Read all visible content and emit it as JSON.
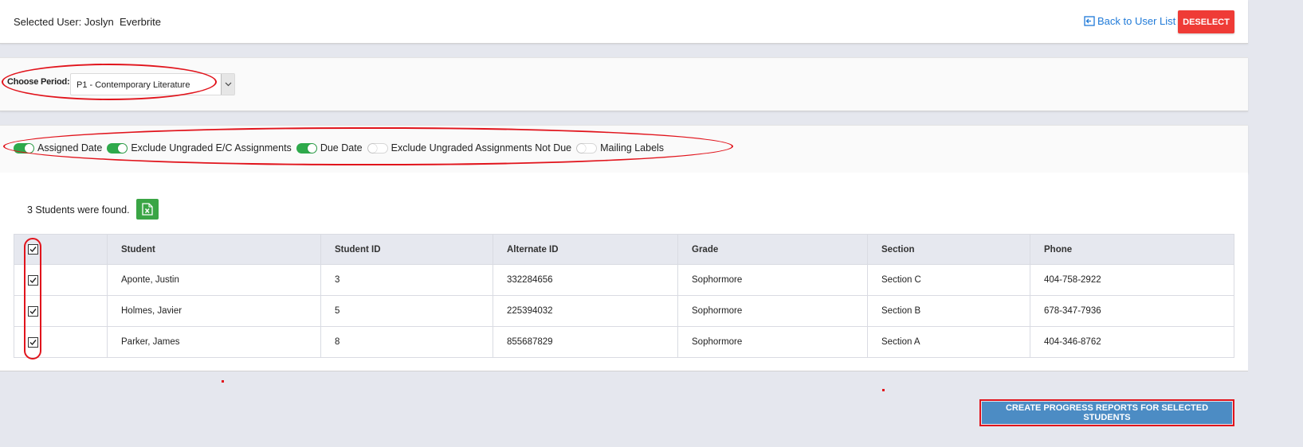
{
  "user_bar": {
    "selected_user": "Selected User: Joslyn  Everbrite",
    "back_link": "Back to User List",
    "deselect_label": "DESELECT"
  },
  "period": {
    "label": "Choose Period:",
    "selected": "P1 - Contemporary Literature"
  },
  "options": [
    {
      "label": "Assigned Date",
      "on": true
    },
    {
      "label": "Exclude Ungraded E/C Assignments",
      "on": true
    },
    {
      "label": "Due Date",
      "on": true
    },
    {
      "label": "Exclude Ungraded Assignments Not Due",
      "on": false
    },
    {
      "label": "Mailing Labels",
      "on": false
    }
  ],
  "results": {
    "count_text": "3 Students were found.",
    "columns": [
      "Student",
      "Student ID",
      "Alternate ID",
      "Grade",
      "Section",
      "Phone"
    ],
    "rows": [
      {
        "checked": true,
        "cells": [
          "Aponte, Justin",
          "3",
          "332284656",
          "Sophormore",
          "Section C",
          "404-758-2922"
        ]
      },
      {
        "checked": true,
        "cells": [
          "Holmes, Javier",
          "5",
          "225394032",
          "Sophormore",
          "Section B",
          "678-347-7936"
        ]
      },
      {
        "checked": true,
        "cells": [
          "Parker, James",
          "8",
          "855687829",
          "Sophormore",
          "Section A",
          "404-346-8762"
        ]
      }
    ]
  },
  "actions": {
    "create_label": "CREATE PROGRESS REPORTS FOR SELECTED STUDENTS"
  },
  "colors": {
    "accent_red": "#ef3b36",
    "toggle_on": "#2ea94b",
    "link_blue": "#1f7ad8",
    "action_blue": "#4c8cc4",
    "annotation_red": "#e1141c"
  }
}
